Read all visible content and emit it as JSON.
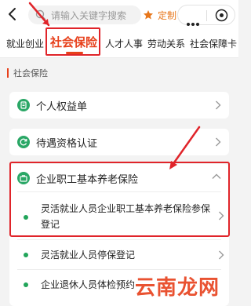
{
  "search": {
    "placeholder": "请输入关键字搜索"
  },
  "custom": {
    "label": "定制"
  },
  "tabs": [
    {
      "label": "就业创业"
    },
    {
      "label": "社会保险"
    },
    {
      "label": "人才人事"
    },
    {
      "label": "劳动关系"
    },
    {
      "label": "社会保障卡"
    }
  ],
  "section": {
    "title": "社会保险"
  },
  "items": [
    {
      "label": "个人权益单",
      "icon": "document-icon"
    },
    {
      "label": "待遇资格认证",
      "icon": "refresh-icon"
    },
    {
      "label": "企业职工基本养老保险",
      "icon": "briefcase-icon",
      "sub_items": [
        {
          "label": "灵活就业人员企业职工基本养老保险参保登记"
        },
        {
          "label": "灵活就业人员停保登记"
        },
        {
          "label": "企业退休人员体检预约"
        }
      ]
    }
  ],
  "watermark": {
    "text": "云南龙网"
  },
  "colors": {
    "accent": "#e7401b",
    "dot": "#22a55a",
    "annotation": "#e0242a"
  }
}
